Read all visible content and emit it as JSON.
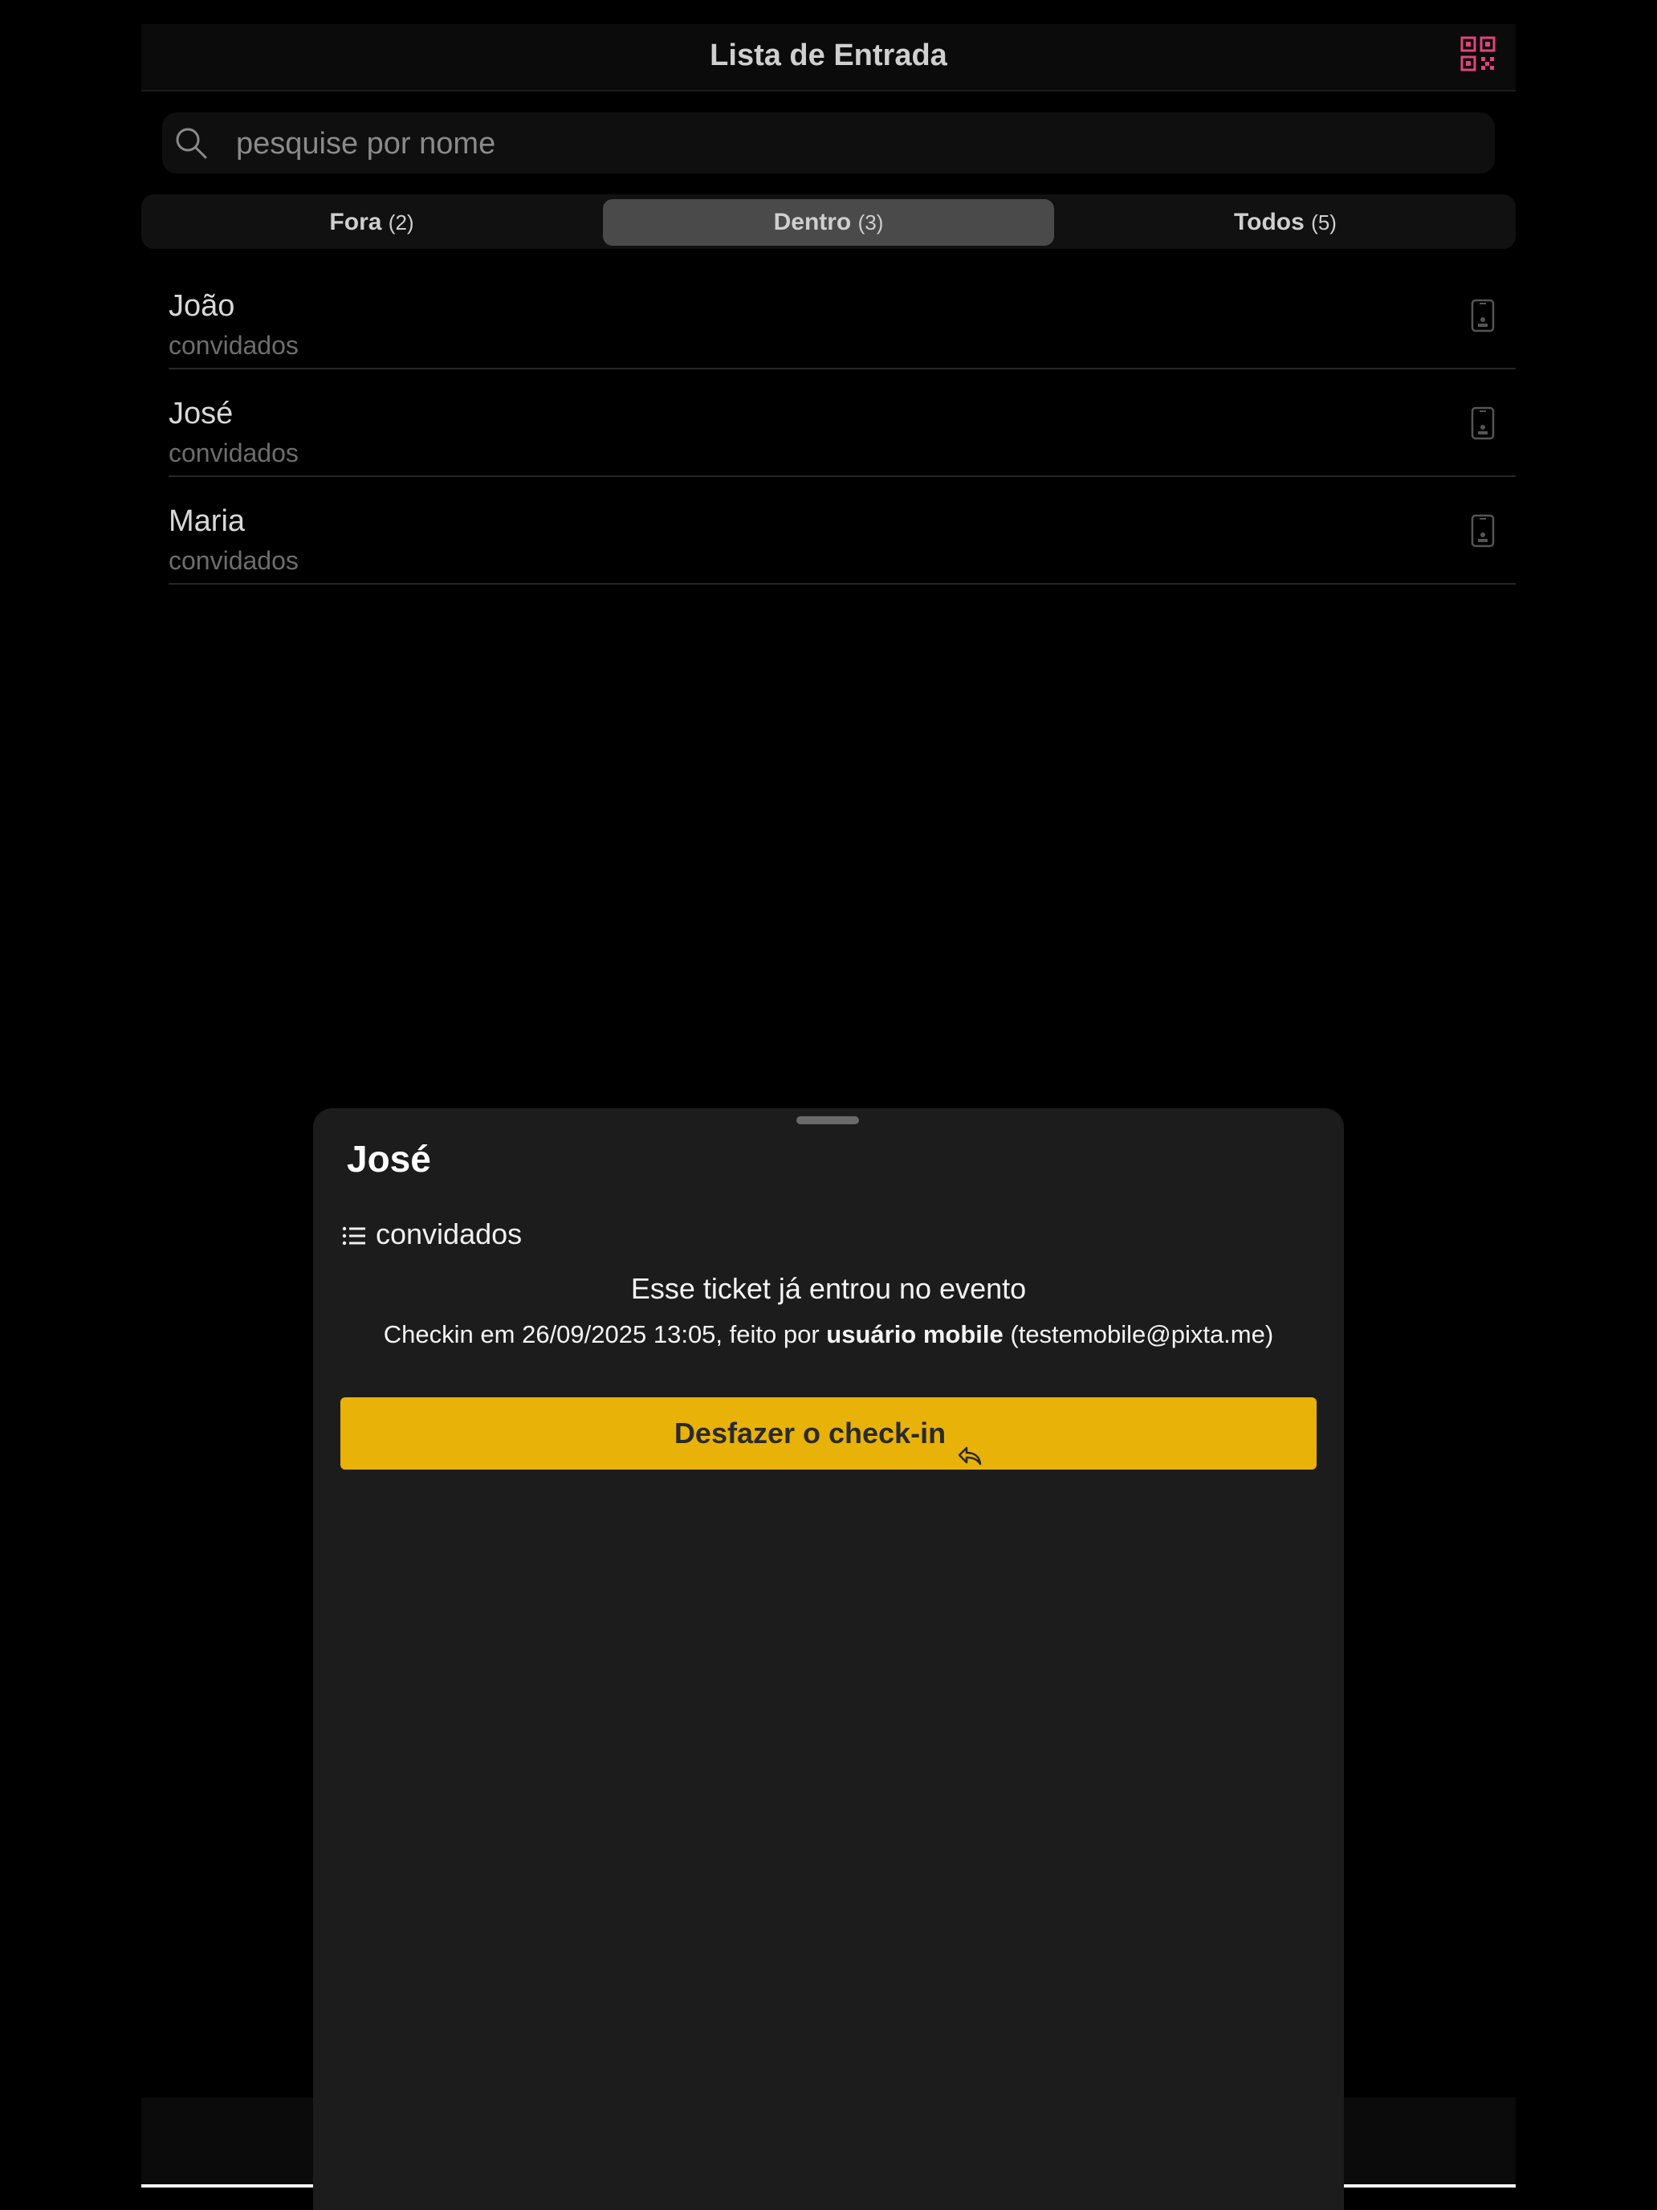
{
  "header": {
    "title": "Lista de Entrada",
    "qr_icon": "qr-code-icon",
    "accent": "#e0457b"
  },
  "search": {
    "placeholder": "pesquise por nome",
    "value": ""
  },
  "tabs": [
    {
      "label": "Fora",
      "count": "(2)",
      "active": false
    },
    {
      "label": "Dentro",
      "count": "(3)",
      "active": true
    },
    {
      "label": "Todos",
      "count": "(5)",
      "active": false
    }
  ],
  "guests": [
    {
      "name": "João",
      "group": "convidados",
      "icon": "mobile-ticket-icon"
    },
    {
      "name": "José",
      "group": "convidados",
      "icon": "mobile-ticket-icon"
    },
    {
      "name": "Maria",
      "group": "convidados",
      "icon": "mobile-ticket-icon"
    }
  ],
  "sheet": {
    "name": "José",
    "list_label": "convidados",
    "status_message": "Esse ticket já entrou no evento",
    "checkin_prefix": "Checkin em 26/09/2025 13:05, feito por ",
    "checkin_user": "usuário mobile",
    "checkin_email": " (testemobile@pixta.me)",
    "undo_label": "Desfazer o check-in",
    "undo_color": "#e8b208"
  }
}
